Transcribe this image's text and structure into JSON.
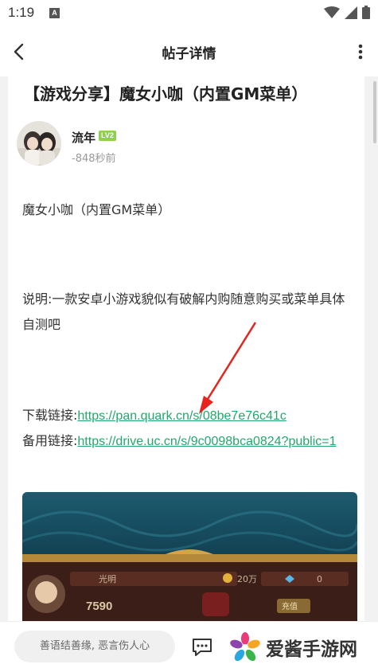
{
  "status_bar": {
    "time": "1:19",
    "notification_icon_letter": "A"
  },
  "app_bar": {
    "title": "帖子详情"
  },
  "post": {
    "title": "【游戏分享】魔女小咖（内置GM菜单）",
    "author": {
      "name": "流年",
      "level": "LV2"
    },
    "time": "-848秒前",
    "paragraphs": [
      "魔女小咖（内置GM菜单）",
      "说明:一款安卓小游戏貌似有破解内购随意购买或菜单具体自测吧"
    ],
    "download": {
      "label": "下载链接:",
      "url": "https://pan.quark.cn/s/08be7e76c41c"
    },
    "backup": {
      "label": "备用链接:",
      "url": "https://drive.uc.cn/s/9c0098bca0824?public=1"
    },
    "game_screenshot": {
      "hud_name": "光明",
      "gold": "20万",
      "gems": "0",
      "power": "7590",
      "recharge": "充值"
    }
  },
  "bottom_bar": {
    "comment_placeholder": "善语结善缘, 恶言伤人心",
    "watermark_text": "爱酱手游网"
  },
  "colors": {
    "link": "#22a86b",
    "level_badge": "#8fd14f",
    "annotation_arrow": "#e8221c"
  }
}
